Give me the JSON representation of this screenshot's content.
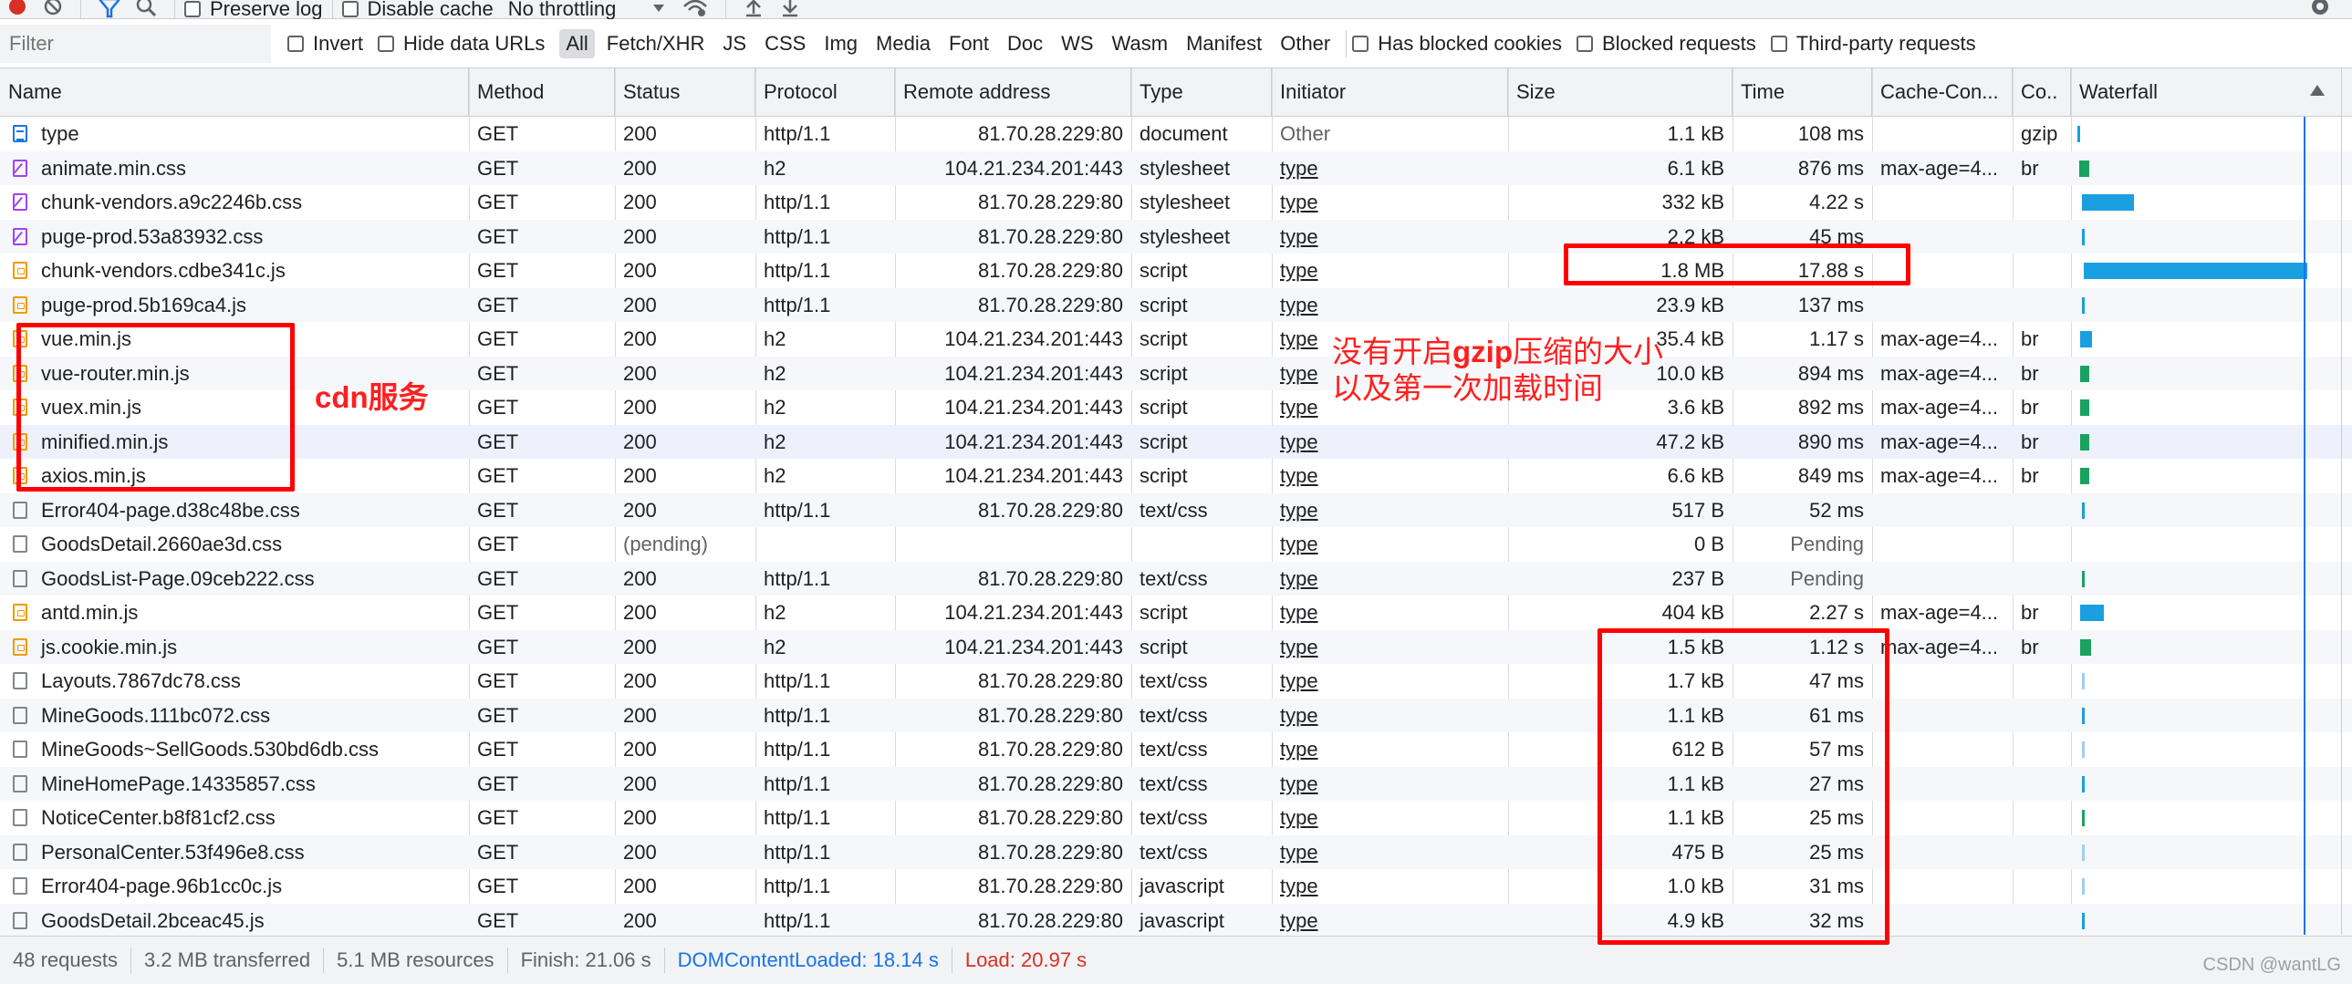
{
  "toolbar": {
    "preserve_log": "Preserve log",
    "disable_cache": "Disable cache",
    "throttling": "No throttling"
  },
  "filterbar": {
    "filter_placeholder": "Filter",
    "invert": "Invert",
    "hide_data_urls": "Hide data URLs",
    "types": [
      "All",
      "Fetch/XHR",
      "JS",
      "CSS",
      "Img",
      "Media",
      "Font",
      "Doc",
      "WS",
      "Wasm",
      "Manifest",
      "Other"
    ],
    "has_blocked_cookies": "Has blocked cookies",
    "blocked_requests": "Blocked requests",
    "third_party_requests": "Third-party requests"
  },
  "columns": {
    "name": "Name",
    "method": "Method",
    "status": "Status",
    "protocol": "Protocol",
    "remote": "Remote address",
    "type": "Type",
    "initiator": "Initiator",
    "size": "Size",
    "time": "Time",
    "cache": "Cache-Con...",
    "co": "Co..",
    "waterfall": "Waterfall"
  },
  "rows": [
    {
      "name": "type",
      "icon": "document",
      "method": "GET",
      "status": "200",
      "protocol": "http/1.1",
      "remote": "81.70.28.229:80",
      "type": "document",
      "initiator": "Other",
      "size": "1.1 kB",
      "time": "108 ms",
      "cache": "",
      "co": "gzip",
      "wf_start": 0.8,
      "wf_width": 1.0,
      "wf_color": "#1a9fe0"
    },
    {
      "name": "animate.min.css",
      "icon": "stylesheet",
      "method": "GET",
      "status": "200",
      "protocol": "h2",
      "remote": "104.21.234.201:443",
      "type": "stylesheet",
      "initiator": "type",
      "size": "6.1 kB",
      "time": "876 ms",
      "cache": "max-age=4...",
      "co": "br",
      "wf_start": 1.5,
      "wf_width": 4.0,
      "wf_color": "#1aa260"
    },
    {
      "name": "chunk-vendors.a9c2246b.css",
      "icon": "stylesheet",
      "method": "GET",
      "status": "200",
      "protocol": "http/1.1",
      "remote": "81.70.28.229:80",
      "type": "stylesheet",
      "initiator": "type",
      "size": "332 kB",
      "time": "4.22 s",
      "cache": "",
      "co": "",
      "wf_start": 2.6,
      "wf_width": 21.5,
      "wf_color": "#1a9fe0"
    },
    {
      "name": "puge-prod.53a83932.css",
      "icon": "stylesheet",
      "method": "GET",
      "status": "200",
      "protocol": "http/1.1",
      "remote": "81.70.28.229:80",
      "type": "stylesheet",
      "initiator": "type",
      "size": "2.2 kB",
      "time": "45 ms",
      "cache": "",
      "co": "",
      "wf_start": 2.6,
      "wf_width": 1.0,
      "wf_color": "#1a9fe0"
    },
    {
      "name": "chunk-vendors.cdbe341c.js",
      "icon": "script",
      "method": "GET",
      "status": "200",
      "protocol": "http/1.1",
      "remote": "81.70.28.229:80",
      "type": "script",
      "initiator": "type",
      "size": "1.8 MB",
      "time": "17.88 s",
      "cache": "",
      "co": "",
      "wf_start": 3.5,
      "wf_width": 92.0,
      "wf_color": "#1a9fe0"
    },
    {
      "name": "puge-prod.5b169ca4.js",
      "icon": "script",
      "method": "GET",
      "status": "200",
      "protocol": "http/1.1",
      "remote": "81.70.28.229:80",
      "type": "script",
      "initiator": "type",
      "size": "23.9 kB",
      "time": "137 ms",
      "cache": "",
      "co": "",
      "wf_start": 2.6,
      "wf_width": 1.2,
      "wf_color": "#1a9fe0"
    },
    {
      "name": "vue.min.js",
      "icon": "script",
      "method": "GET",
      "status": "200",
      "protocol": "h2",
      "remote": "104.21.234.201:443",
      "type": "script",
      "initiator": "type",
      "size": "35.4 kB",
      "time": "1.17 s",
      "cache": "max-age=4...",
      "co": "br",
      "wf_start": 1.8,
      "wf_width": 5.0,
      "wf_color": "#1a9fe0"
    },
    {
      "name": "vue-router.min.js",
      "icon": "script",
      "method": "GET",
      "status": "200",
      "protocol": "h2",
      "remote": "104.21.234.201:443",
      "type": "script",
      "initiator": "type",
      "size": "10.0 kB",
      "time": "894 ms",
      "cache": "max-age=4...",
      "co": "br",
      "wf_start": 1.8,
      "wf_width": 4.0,
      "wf_color": "#1aa260"
    },
    {
      "name": "vuex.min.js",
      "icon": "script",
      "method": "GET",
      "status": "200",
      "protocol": "h2",
      "remote": "104.21.234.201:443",
      "type": "script",
      "initiator": "type",
      "size": "3.6 kB",
      "time": "892 ms",
      "cache": "max-age=4...",
      "co": "br",
      "wf_start": 1.8,
      "wf_width": 4.0,
      "wf_color": "#1aa260"
    },
    {
      "name": "minified.min.js",
      "icon": "script",
      "method": "GET",
      "status": "200",
      "protocol": "h2",
      "remote": "104.21.234.201:443",
      "type": "script",
      "initiator": "type",
      "size": "47.2 kB",
      "time": "890 ms",
      "cache": "max-age=4...",
      "co": "br",
      "wf_start": 1.8,
      "wf_width": 4.0,
      "wf_color": "#1aa260"
    },
    {
      "name": "axios.min.js",
      "icon": "script",
      "method": "GET",
      "status": "200",
      "protocol": "h2",
      "remote": "104.21.234.201:443",
      "type": "script",
      "initiator": "type",
      "size": "6.6 kB",
      "time": "849 ms",
      "cache": "max-age=4...",
      "co": "br",
      "wf_start": 1.8,
      "wf_width": 4.0,
      "wf_color": "#1aa260"
    },
    {
      "name": "Error404-page.d38c48be.css",
      "icon": "other",
      "method": "GET",
      "status": "200",
      "protocol": "http/1.1",
      "remote": "81.70.28.229:80",
      "type": "text/css",
      "initiator": "type",
      "size": "517 B",
      "time": "52 ms",
      "cache": "",
      "co": "",
      "wf_start": 2.6,
      "wf_width": 1.0,
      "wf_color": "#1a9fe0"
    },
    {
      "name": "GoodsDetail.2660ae3d.css",
      "icon": "other",
      "method": "GET",
      "status": "(pending)",
      "protocol": "",
      "remote": "",
      "type": "",
      "initiator": "type",
      "size": "0 B",
      "time": "Pending",
      "cache": "",
      "co": "",
      "wf_start": 0,
      "wf_width": 0,
      "wf_color": "#1a9fe0"
    },
    {
      "name": "GoodsList-Page.09ceb222.css",
      "icon": "other",
      "method": "GET",
      "status": "200",
      "protocol": "http/1.1",
      "remote": "81.70.28.229:80",
      "type": "text/css",
      "initiator": "type",
      "size": "237 B",
      "time": "Pending",
      "cache": "",
      "co": "",
      "wf_start": 2.6,
      "wf_width": 1.0,
      "wf_color": "#1aa260"
    },
    {
      "name": "antd.min.js",
      "icon": "script",
      "method": "GET",
      "status": "200",
      "protocol": "h2",
      "remote": "104.21.234.201:443",
      "type": "script",
      "initiator": "type",
      "size": "404 kB",
      "time": "2.27 s",
      "cache": "max-age=4...",
      "co": "br",
      "wf_start": 1.8,
      "wf_width": 10.0,
      "wf_color": "#1a9fe0"
    },
    {
      "name": "js.cookie.min.js",
      "icon": "script",
      "method": "GET",
      "status": "200",
      "protocol": "h2",
      "remote": "104.21.234.201:443",
      "type": "script",
      "initiator": "type",
      "size": "1.5 kB",
      "time": "1.12 s",
      "cache": "max-age=4...",
      "co": "br",
      "wf_start": 1.8,
      "wf_width": 4.5,
      "wf_color": "#1aa260"
    },
    {
      "name": "Layouts.7867dc78.css",
      "icon": "other",
      "method": "GET",
      "status": "200",
      "protocol": "http/1.1",
      "remote": "81.70.28.229:80",
      "type": "text/css",
      "initiator": "type",
      "size": "1.7 kB",
      "time": "47 ms",
      "cache": "",
      "co": "",
      "wf_start": 2.6,
      "wf_width": 0.8,
      "wf_color": "#9ed0f0"
    },
    {
      "name": "MineGoods.111bc072.css",
      "icon": "other",
      "method": "GET",
      "status": "200",
      "protocol": "http/1.1",
      "remote": "81.70.28.229:80",
      "type": "text/css",
      "initiator": "type",
      "size": "1.1 kB",
      "time": "61 ms",
      "cache": "",
      "co": "",
      "wf_start": 2.6,
      "wf_width": 0.8,
      "wf_color": "#1a9fe0"
    },
    {
      "name": "MineGoods~SellGoods.530bd6db.css",
      "icon": "other",
      "method": "GET",
      "status": "200",
      "protocol": "http/1.1",
      "remote": "81.70.28.229:80",
      "type": "text/css",
      "initiator": "type",
      "size": "612 B",
      "time": "57 ms",
      "cache": "",
      "co": "",
      "wf_start": 2.6,
      "wf_width": 0.8,
      "wf_color": "#9ed0f0"
    },
    {
      "name": "MineHomePage.14335857.css",
      "icon": "other",
      "method": "GET",
      "status": "200",
      "protocol": "http/1.1",
      "remote": "81.70.28.229:80",
      "type": "text/css",
      "initiator": "type",
      "size": "1.1 kB",
      "time": "27 ms",
      "cache": "",
      "co": "",
      "wf_start": 2.6,
      "wf_width": 1.0,
      "wf_color": "#1a9fe0"
    },
    {
      "name": "NoticeCenter.b8f81cf2.css",
      "icon": "other",
      "method": "GET",
      "status": "200",
      "protocol": "http/1.1",
      "remote": "81.70.28.229:80",
      "type": "text/css",
      "initiator": "type",
      "size": "1.1 kB",
      "time": "25 ms",
      "cache": "",
      "co": "",
      "wf_start": 2.6,
      "wf_width": 1.0,
      "wf_color": "#1aa260"
    },
    {
      "name": "PersonalCenter.53f496e8.css",
      "icon": "other",
      "method": "GET",
      "status": "200",
      "protocol": "http/1.1",
      "remote": "81.70.28.229:80",
      "type": "text/css",
      "initiator": "type",
      "size": "475 B",
      "time": "25 ms",
      "cache": "",
      "co": "",
      "wf_start": 2.6,
      "wf_width": 0.8,
      "wf_color": "#9ed0f0"
    },
    {
      "name": "Error404-page.96b1cc0c.js",
      "icon": "other",
      "method": "GET",
      "status": "200",
      "protocol": "http/1.1",
      "remote": "81.70.28.229:80",
      "type": "javascript",
      "initiator": "type",
      "size": "1.0 kB",
      "time": "31 ms",
      "cache": "",
      "co": "",
      "wf_start": 2.6,
      "wf_width": 0.8,
      "wf_color": "#9ed0f0"
    },
    {
      "name": "GoodsDetail.2bceac45.js",
      "icon": "other",
      "method": "GET",
      "status": "200",
      "protocol": "http/1.1",
      "remote": "81.70.28.229:80",
      "type": "javascript",
      "initiator": "type",
      "size": "4.9 kB",
      "time": "32 ms",
      "cache": "",
      "co": "",
      "wf_start": 2.6,
      "wf_width": 1.0,
      "wf_color": "#1a9fe0"
    }
  ],
  "statusbar": {
    "requests": "48 requests",
    "transferred": "3.2 MB transferred",
    "resources": "5.1 MB resources",
    "finish": "Finish: 21.06 s",
    "dom_content_loaded": "DOMContentLoaded: 18.14 s",
    "load": "Load: 20.97 s",
    "dcl_color": "#1a73e8",
    "load_color": "#d93025"
  },
  "annotations": {
    "cdn_label": "cdn服务",
    "gzip_line1_a": "没有开启",
    "gzip_line1_b": "gzip",
    "gzip_line1_c": "压缩的大小",
    "gzip_line2": "以及第一次加载时间",
    "color": "#ff0000"
  },
  "watermark": "CSDN @wantLG"
}
